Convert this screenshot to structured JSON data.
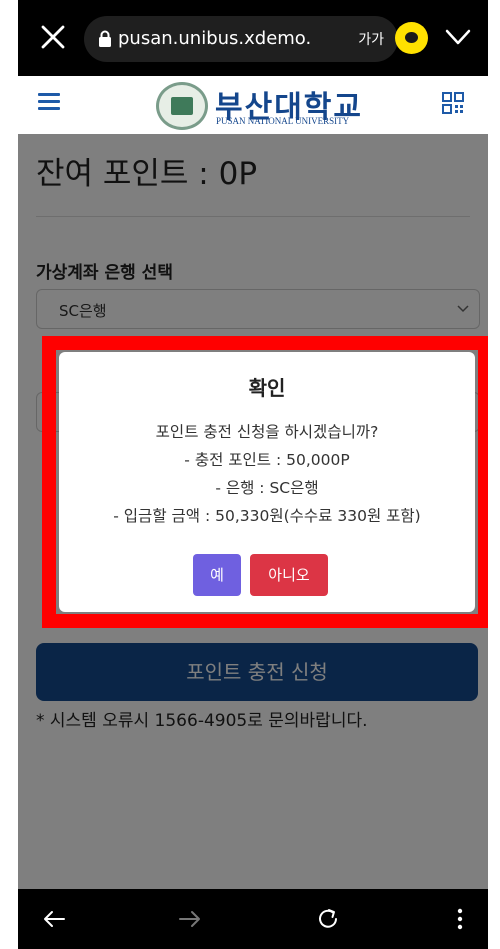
{
  "browser": {
    "url": "pusan.unibus.xdemo.",
    "text_size_label": "가가"
  },
  "header": {
    "university_name_ko": "부산대학교",
    "university_name_en": "PUSAN NATIONAL UNIVERSITY"
  },
  "page": {
    "balance_text": "잔여 포인트 : 0P",
    "bank_label": "가상계좌 은행 선택",
    "bank_selected": "SC은행",
    "submit_label": "포인트 충전 신청",
    "contact_note": "* 시스템 오류시 1566-4905로 문의바랍니다."
  },
  "modal": {
    "title": "확인",
    "question": "포인트 충전 신청을 하시겠습니까?",
    "line_points": "- 충전 포인트 : 50,000P",
    "line_bank": "- 은행 : SC은행",
    "line_amount": "- 입금할 금액 : 50,330원(수수료 330원 포함)",
    "yes_label": "예",
    "no_label": "아니오"
  },
  "colors": {
    "brand_blue": "#144b8e",
    "yes_button": "#6f60e0",
    "no_button": "#dc3545",
    "highlight_frame": "#ff0000"
  }
}
